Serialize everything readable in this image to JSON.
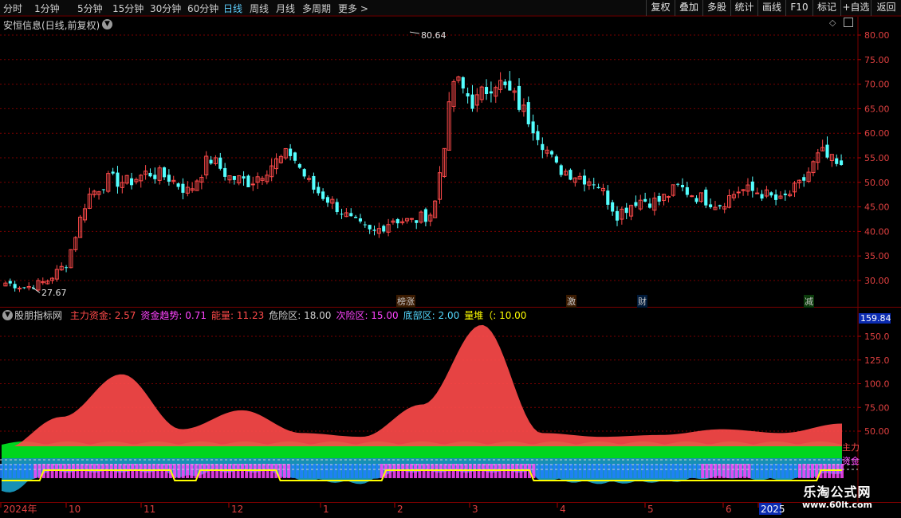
{
  "toolbar": {
    "periods": [
      "分时",
      "1分钟",
      "5分钟",
      "15分钟",
      "30分钟",
      "60分钟",
      "日线",
      "周线",
      "月线",
      "多周期",
      "更多 >"
    ],
    "active_period": "日线",
    "tools": [
      "复权",
      "叠加",
      "多股",
      "统计",
      "画线",
      "F10",
      "标记",
      "+自选",
      "返回"
    ]
  },
  "main_chart": {
    "title": "安恒信息(日线,前复权)",
    "price_ticks": [
      "80.00",
      "75.00",
      "70.00",
      "65.00",
      "60.00",
      "55.00",
      "50.00",
      "45.00",
      "40.00",
      "35.00",
      "30.00"
    ],
    "high_label": "80.64",
    "low_label": "27.67",
    "tags": [
      {
        "text": "榜涨",
        "color": "#ff6a3d"
      },
      {
        "text": "激",
        "color": "#ff6a3d"
      },
      {
        "text": "财",
        "color": "#5fa8ff"
      },
      {
        "text": "减",
        "color": "#60d060"
      }
    ],
    "colors": {
      "up": "#ff4a4a",
      "down": "#54ffff"
    }
  },
  "indicator": {
    "name": "股朋指标网",
    "values": [
      {
        "key": "主力资金",
        "value": "2.57",
        "color": "#ff4a4a"
      },
      {
        "key": "资金趋势",
        "value": "0.71",
        "color": "#ff44ff"
      },
      {
        "key": "能量",
        "value": "11.23",
        "color": "#ff4a4a"
      },
      {
        "key": "危险区",
        "value": "18.00",
        "color": "#d0d0d0"
      },
      {
        "key": "次险区",
        "value": "15.00",
        "color": "#ff44ff"
      },
      {
        "key": "底部区",
        "value": "2.00",
        "color": "#54d8ff"
      },
      {
        "key": "量堆（",
        "value": "10.00",
        "color": "#ffff00"
      }
    ],
    "current_value": "159.84",
    "ticks": [
      "150.0",
      "125.0",
      "100.0",
      "75.00",
      "50.00"
    ],
    "side_labels": [
      "主力",
      "资金"
    ],
    "colors": {
      "main_fund": "#ff4a4a",
      "fund_trend": "#ff44ff",
      "bottom": "#1aa0c8",
      "danger": "#00e020",
      "stack_line": "#ffff00"
    }
  },
  "time_axis": [
    "2024年",
    "10",
    "11",
    "12",
    "1",
    "2",
    "3",
    "4",
    "5",
    "6",
    "2025"
  ],
  "watermark": {
    "title": "乐淘公式网",
    "url": "www.60lt.com"
  },
  "chart_data": [
    {
      "type": "candlestick",
      "title": "安恒信息(日线,前复权)",
      "x": [
        "2024-09-09",
        "2024-09-13",
        "2024-09-20",
        "2024-09-26",
        "2024-09-30",
        "2024-10-08",
        "2024-10-14",
        "2024-10-21",
        "2024-10-28",
        "2024-11-04",
        "2024-11-11",
        "2024-11-18",
        "2024-11-25",
        "2024-12-02",
        "2024-12-09",
        "2024-12-16",
        "2024-12-23",
        "2024-12-30",
        "2025-01-06",
        "2025-01-13",
        "2025-01-20",
        "2025-02-05",
        "2025-02-10",
        "2025-02-17",
        "2025-02-24",
        "2025-03-03",
        "2025-03-10",
        "2025-03-17",
        "2025-03-24",
        "2025-03-31",
        "2025-04-08",
        "2025-04-14",
        "2025-04-21",
        "2025-04-28",
        "2025-05-12",
        "2025-05-19",
        "2025-05-26",
        "2025-06-03",
        "2025-06-09",
        "2025-06-16",
        "2025-06-23",
        "2025-06-30"
      ],
      "close": [
        29.5,
        28.6,
        29.8,
        33.5,
        47.0,
        50.5,
        50.0,
        52.0,
        51.0,
        48.0,
        55.0,
        51.0,
        50.0,
        53.5,
        56.0,
        49.0,
        46.0,
        42.0,
        39.5,
        42.5,
        42.0,
        44.0,
        71.0,
        66.0,
        71.0,
        67.0,
        61.0,
        53.0,
        51.5,
        50.0,
        43.5,
        46.5,
        46.0,
        49.0,
        47.0,
        45.5,
        48.5,
        48.0,
        46.0,
        49.5,
        56.0,
        52.5
      ],
      "high_label": 80.64,
      "low_label": 27.67,
      "ylim": [
        27,
        82
      ]
    },
    {
      "type": "area",
      "title": "股朋指标网",
      "x": [
        "2024-09",
        "2024-10-01",
        "2024-10-08",
        "2024-10-20",
        "2024-11-11",
        "2024-12-10",
        "2025-01-15",
        "2025-02-05",
        "2025-02-12",
        "2025-02-20",
        "2025-03-20",
        "2025-04-08",
        "2025-05-10",
        "2025-06-05",
        "2025-06-30"
      ],
      "series": [
        {
          "name": "主力资金",
          "values": [
            30,
            65,
            110,
            52,
            72,
            48,
            44,
            78,
            162,
            48,
            44,
            46,
            52,
            48,
            58
          ]
        }
      ],
      "current": 159.84,
      "ylim": [
        0,
        170
      ]
    }
  ]
}
